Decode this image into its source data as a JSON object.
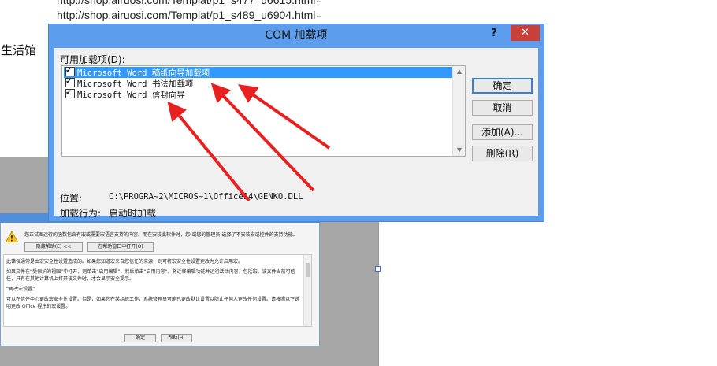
{
  "document": {
    "line1": "http://shop.airuosi.com/Templat/p1_s477_u6615.html",
    "line2": "http://shop.airuosi.com/Templat/p1_s489_u6904.html",
    "pilcrow": "↵",
    "side_text": "生活馆"
  },
  "com_dialog": {
    "title": "COM 加载项",
    "help_glyph": "?",
    "close_glyph": "✕",
    "available_label": "可用加载项(D):",
    "addins": [
      {
        "name": "Microsoft Word 稿纸向导加载项",
        "checked": true,
        "selected": true
      },
      {
        "name": "Microsoft Word 书法加载项",
        "checked": true,
        "selected": false
      },
      {
        "name": "Microsoft Word 信封向导",
        "checked": true,
        "selected": false
      }
    ],
    "location_label": "位置:",
    "location_value": "C:\\PROGRA~2\\MICROS~1\\Office14\\GENKO.DLL",
    "load_behavior_label": "加载行为:",
    "load_behavior_value": "启动时加载",
    "buttons": {
      "ok": "确定",
      "cancel": "取消",
      "add": "添加(A)...",
      "remove": "删除(R)"
    }
  },
  "security_notice": {
    "message": "您正试图运行的函数包含有宏或需要宏语言支持的内容。而在安装此软件时，您(或您的管理员)选择了不安装宏或控件的支持功能。",
    "hide_help_button": "隐藏帮助(E) <<",
    "help_window_button": "在帮助窗口中打开(O)",
    "help_paragraphs": [
      "此错误通常是由宏安全性设置造成的。如果您知道宏来自您信任的来源，则可将宏安全性设置更改为允许启用宏。",
      "如果文件在“受保护的视图”中打开，则单击“启用编辑”，然后单击“启用内容”。将迁移编辑功能并运行活动内容，包括宏。该文件当前可信任，只有在其他计算机上打开该文件时，才会显示安全提示。",
      "“更改宏设置”",
      "可以在信任中心更改宏安全性设置。但是，如果您在某组织工作，系统管理员可能已更改默认设置以防止任何人更改任何设置。请按照以下说明更改 Office 程序的宏设置。"
    ],
    "ok_button": "确定",
    "help_button": "帮助(H)"
  }
}
